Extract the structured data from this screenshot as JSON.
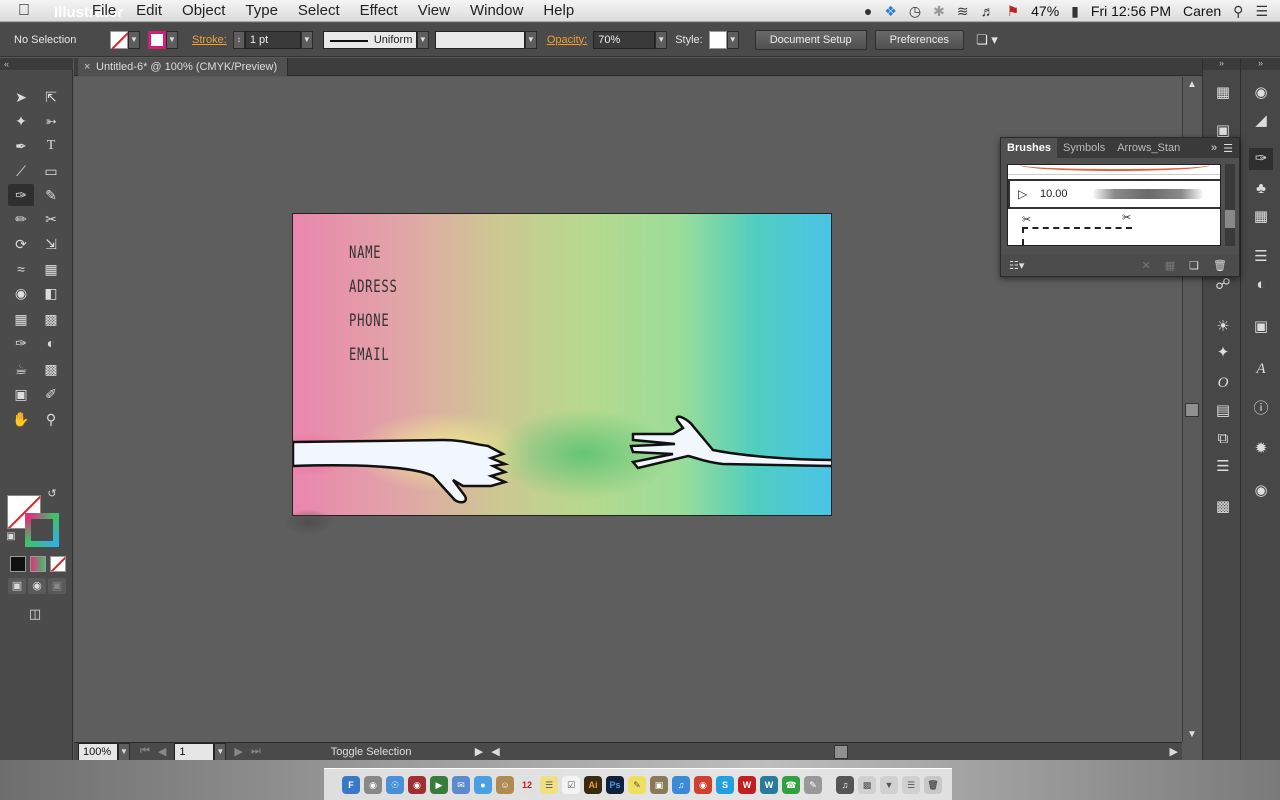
{
  "menubar": {
    "app_name": "Illustrator",
    "menus": [
      "File",
      "Edit",
      "Object",
      "Type",
      "Select",
      "Effect",
      "View",
      "Window",
      "Help"
    ],
    "battery": "47%",
    "datetime": "Fri 12:56 PM",
    "user": "Caren"
  },
  "control_bar": {
    "selection": "No Selection",
    "stroke_label": "Stroke:",
    "stroke_weight": "1 pt",
    "stroke_profile": "Uniform",
    "opacity_label": "Opacity:",
    "opacity_value": "70%",
    "style_label": "Style:",
    "document_setup": "Document Setup",
    "preferences": "Preferences"
  },
  "document": {
    "tab_title": "Untitled-6* @ 100% (CMYK/Preview)",
    "zoom": "100%",
    "artboard_number": "1",
    "status_text": "Toggle Selection"
  },
  "card": {
    "lines": [
      "NAME",
      "ADRESS",
      "PHONE",
      "EMAIL"
    ]
  },
  "brushes_panel": {
    "tabs": [
      "Brushes",
      "Symbols",
      "Arrows_Stan"
    ],
    "selected_size": "10.00"
  },
  "colors": {
    "accent": "#f0a030",
    "stroke_swatch": "#d0207a",
    "ui_dark": "#4a4a4a"
  }
}
